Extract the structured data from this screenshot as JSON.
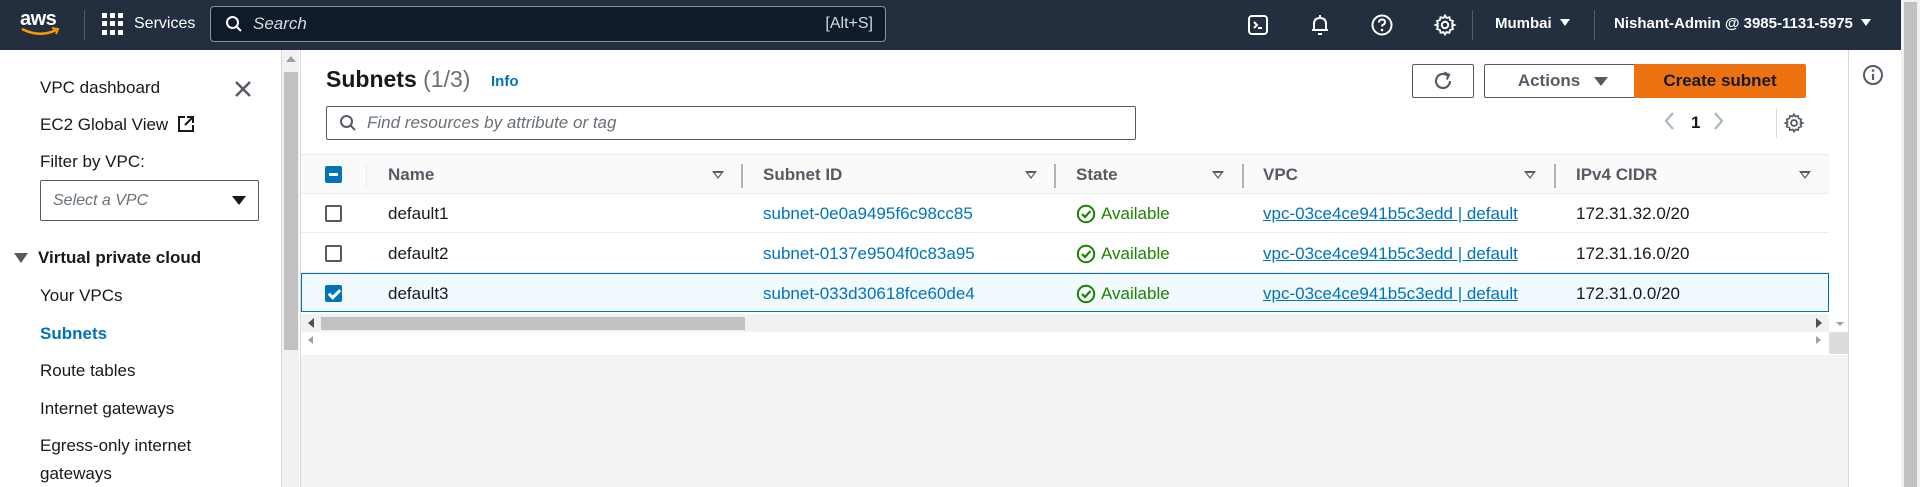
{
  "topnav": {
    "logo_text": "aws",
    "services_label": "Services",
    "search_placeholder": "Search",
    "search_shortcut": "[Alt+S]",
    "region": "Mumbai",
    "account": "Nishant-Admin @ 3985-1131-5975",
    "icons": [
      "cloudshell-icon",
      "notifications-bell-icon",
      "help-icon",
      "settings-gear-icon"
    ]
  },
  "sidebar": {
    "dashboard": "VPC dashboard",
    "global_view": "EC2 Global View",
    "filter_label": "Filter by VPC:",
    "vpc_select_placeholder": "Select a VPC",
    "section_title": "Virtual private cloud",
    "items": [
      {
        "label": "Your VPCs",
        "active": false
      },
      {
        "label": "Subnets",
        "active": true
      },
      {
        "label": "Route tables",
        "active": false
      },
      {
        "label": "Internet gateways",
        "active": false
      },
      {
        "label": "Egress-only internet",
        "active": false
      },
      {
        "label": "gateways",
        "active": false
      }
    ]
  },
  "panel": {
    "title": "Subnets",
    "count": "(1/3)",
    "info": "Info",
    "actions_label": "Actions",
    "create_label": "Create subnet",
    "filter_placeholder": "Find resources by attribute or tag",
    "page_number": "1"
  },
  "table": {
    "columns": [
      "Name",
      "Subnet ID",
      "State",
      "VPC",
      "IPv4 CIDR"
    ],
    "rows": [
      {
        "name": "default1",
        "subnet_id": "subnet-0e0a9495f6c98cc85",
        "state": "Available",
        "vpc": "vpc-03ce4ce941b5c3edd | default",
        "cidr": "172.31.32.0/20",
        "selected": false
      },
      {
        "name": "default2",
        "subnet_id": "subnet-0137e9504f0c83a95",
        "state": "Available",
        "vpc": "vpc-03ce4ce941b5c3edd | default",
        "cidr": "172.31.16.0/20",
        "selected": false
      },
      {
        "name": "default3",
        "subnet_id": "subnet-033d30618fce60de4",
        "state": "Available",
        "vpc": "vpc-03ce4ce941b5c3edd | default",
        "cidr": "172.31.0.0/20",
        "selected": true
      }
    ]
  },
  "colors": {
    "nav_bg": "#232f3e",
    "primary_button": "#ec7211",
    "link": "#0073bb",
    "available": "#1d8102"
  }
}
